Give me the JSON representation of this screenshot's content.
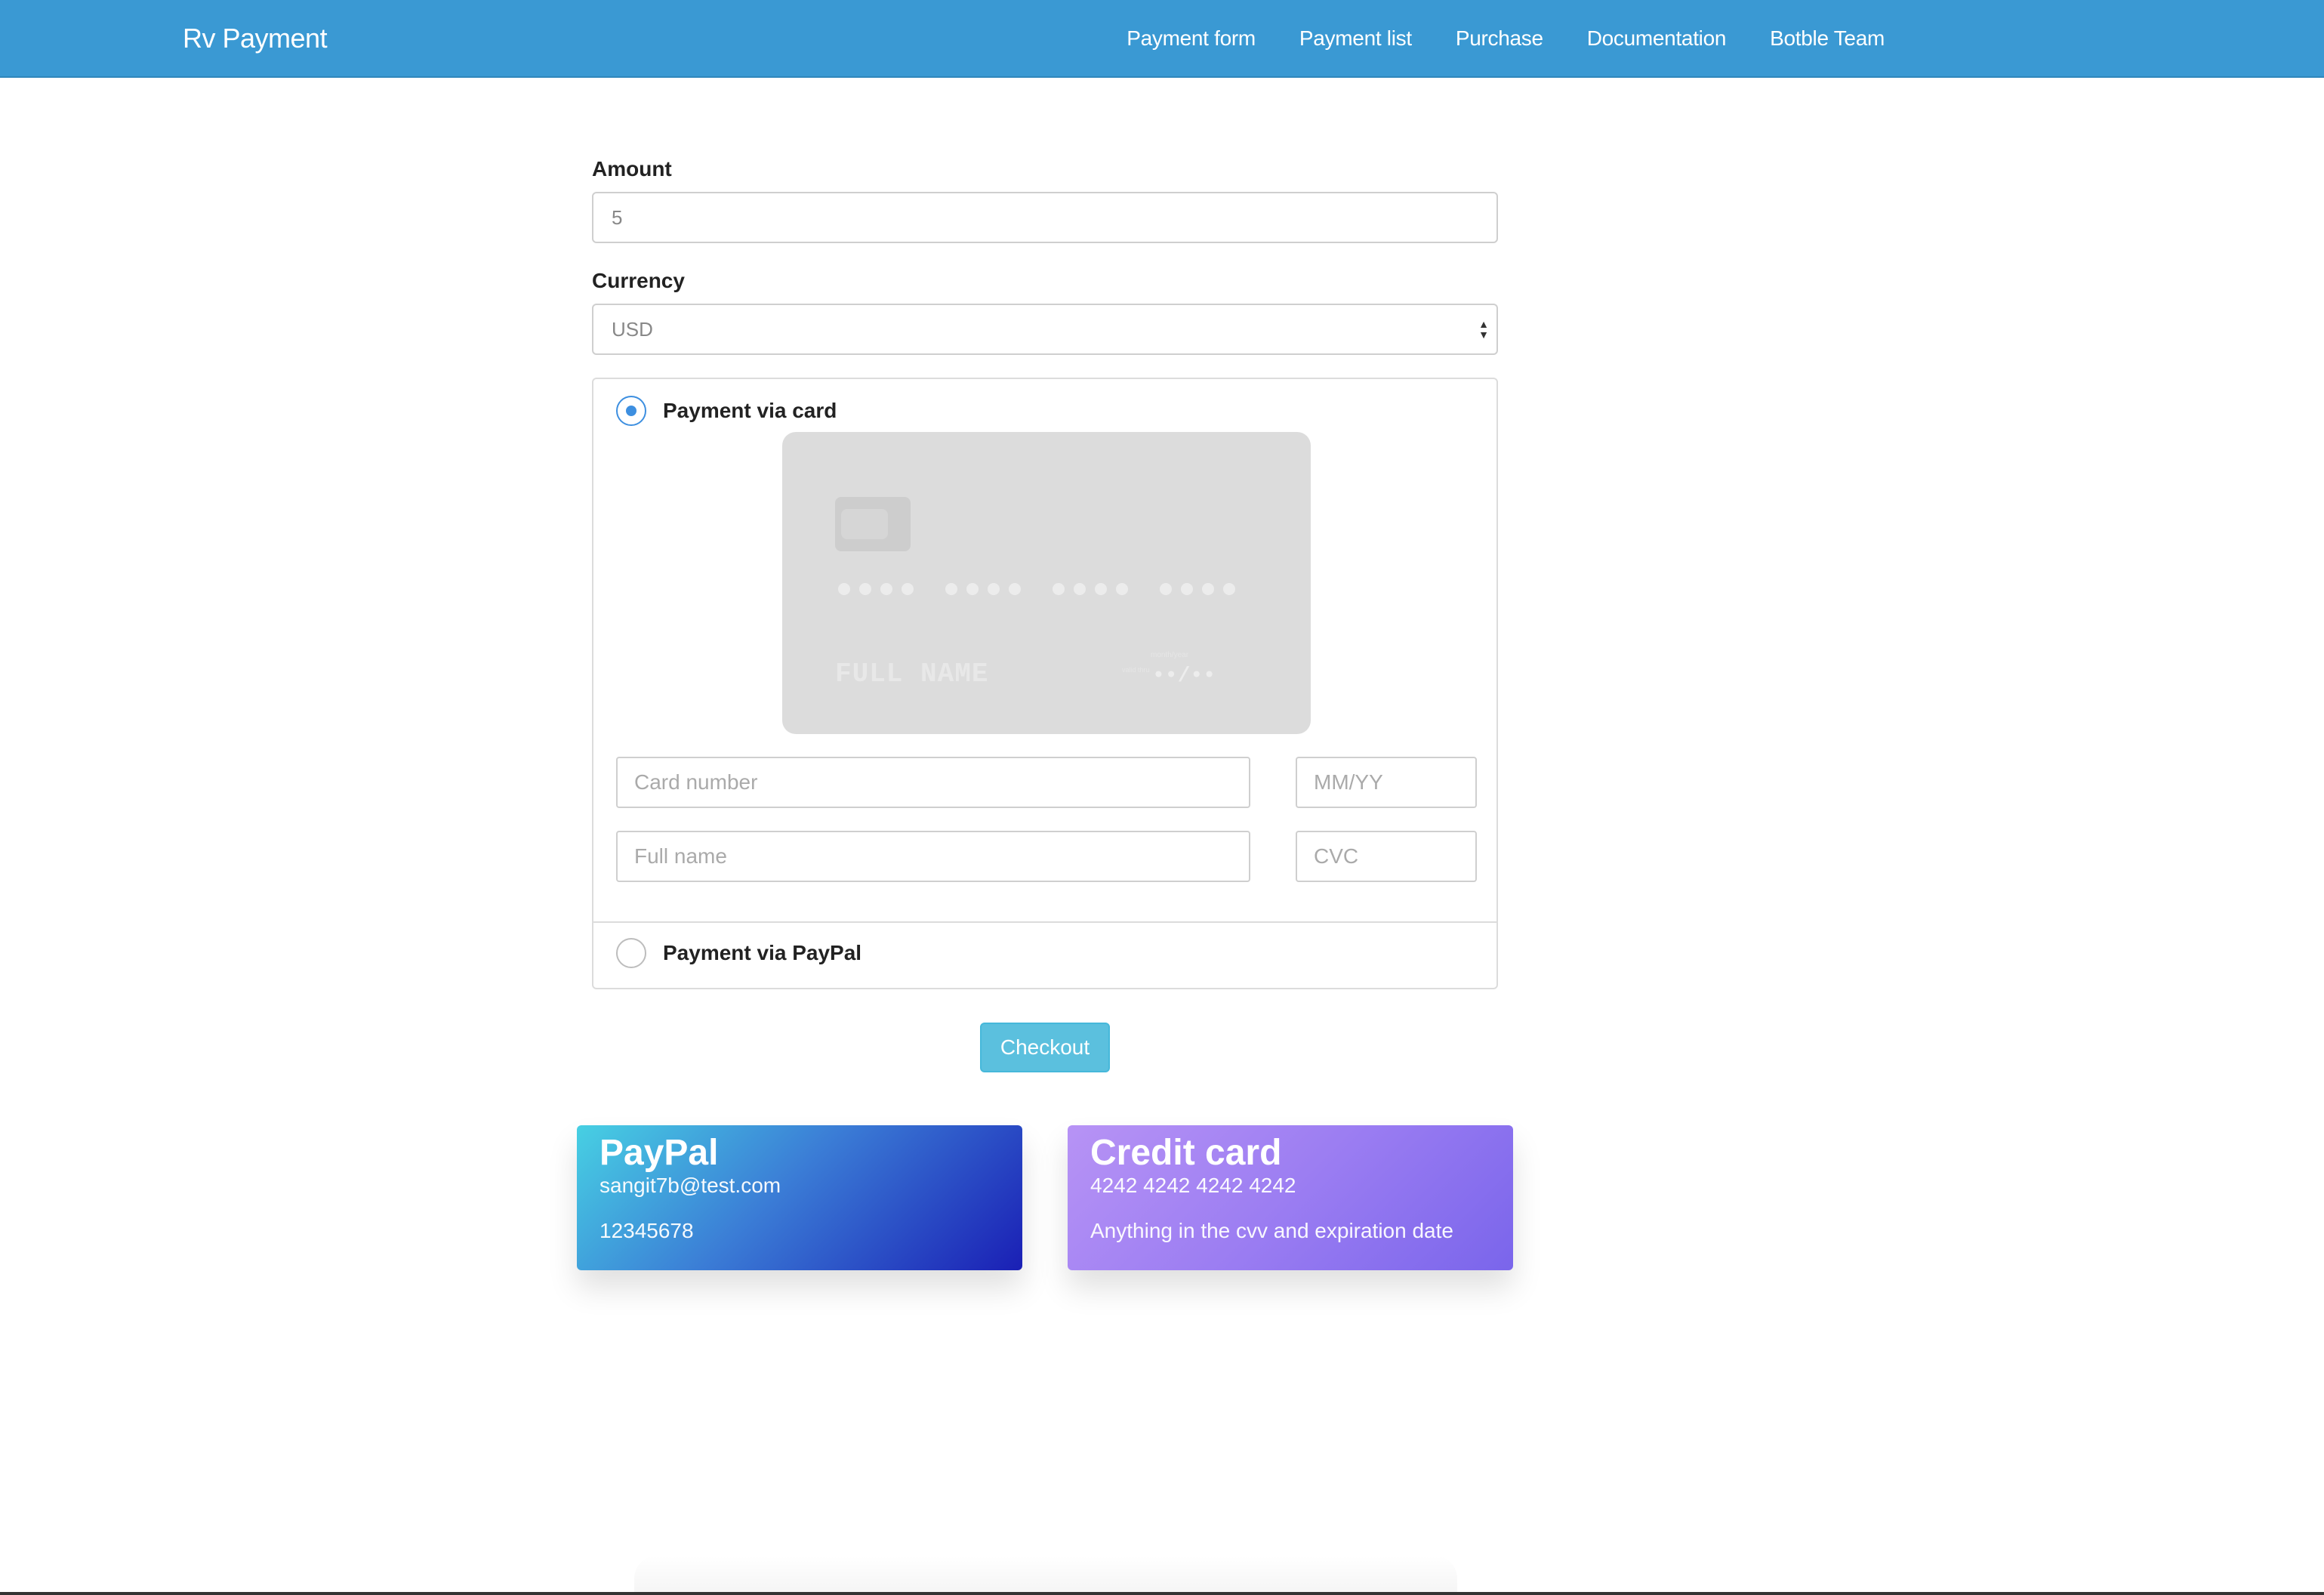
{
  "navbar": {
    "brand": "Rv Payment",
    "links": [
      "Payment form",
      "Payment list",
      "Purchase",
      "Documentation",
      "Botble Team"
    ],
    "color": "#3a99d3"
  },
  "form": {
    "amount_label": "Amount",
    "amount_value": "5",
    "currency_label": "Currency",
    "currency_value": "USD"
  },
  "payment": {
    "card_option_label": "Payment via card",
    "card_option_selected": true,
    "paypal_option_label": "Payment via PayPal",
    "paypal_option_selected": false,
    "card_preview": {
      "name": "FULL NAME",
      "expiry": "••/••",
      "expiry_caption": "month/year",
      "valid_thru": "valid thru"
    },
    "fields": {
      "card_number_placeholder": "Card number",
      "expiry_placeholder": "MM/YY",
      "full_name_placeholder": "Full name",
      "cvc_placeholder": "CVC"
    },
    "checkout_label": "Checkout"
  },
  "info_cards": {
    "paypal": {
      "title": "PayPal",
      "line1": "sangit7b@test.com",
      "line2": "12345678"
    },
    "credit": {
      "title": "Credit card",
      "line1": "4242 4242 4242 4242",
      "line2": "Anything in the cvv and expiration date"
    }
  },
  "icons": {
    "select_arrows": "sort-arrows-icon",
    "card_chip": "chip-icon"
  }
}
